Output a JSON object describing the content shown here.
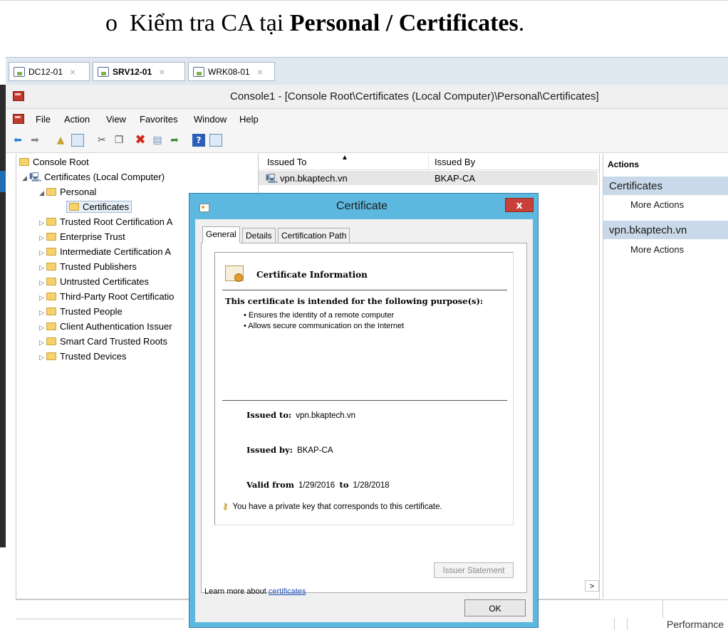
{
  "doc": {
    "bullet": "o",
    "heading_prefix": "Kiểm tra CA tại ",
    "heading_bold": "Personal / Certificates",
    "heading_suffix": "."
  },
  "vm_tabs": [
    {
      "label": "DC12-01",
      "close": "×"
    },
    {
      "label": "SRV12-01",
      "close": "×"
    },
    {
      "label": "WRK08-01",
      "close": "×"
    }
  ],
  "window": {
    "title": "Console1 - [Console Root\\Certificates (Local Computer)\\Personal\\Certificates]"
  },
  "menu": [
    "File",
    "Action",
    "View",
    "Favorites",
    "Window",
    "Help"
  ],
  "tree": {
    "root": "Console Root",
    "store": "Certificates (Local Computer)",
    "personal": "Personal",
    "certificates": "Certificates",
    "items": [
      "Trusted Root Certification A",
      "Enterprise Trust",
      "Intermediate Certification A",
      "Trusted Publishers",
      "Untrusted Certificates",
      "Third-Party Root Certificatio",
      "Trusted People",
      "Client Authentication Issuer",
      "Smart Card Trusted Roots",
      "Trusted Devices"
    ]
  },
  "list": {
    "col_issued_to": "Issued To",
    "col_issued_by": "Issued By",
    "row": {
      "issued_to": "vpn.bkaptech.vn",
      "issued_by": "BKAP-CA"
    }
  },
  "actions": {
    "header": "Actions",
    "group1": "Certificates",
    "group1_item": "More Actions",
    "group2": "vpn.bkaptech.vn",
    "group2_item": "More Actions"
  },
  "status": {
    "perf": "Performance"
  },
  "dialog": {
    "title": "Certificate",
    "close": "x",
    "tabs": [
      "General",
      "Details",
      "Certification Path"
    ],
    "info_title": "Certificate Information",
    "purpose_heading": "This certificate is intended for the following purpose(s):",
    "purposes": [
      "• Ensures the identity of a remote computer",
      "• Allows secure communication on the Internet"
    ],
    "issued_to_label": "Issued to:",
    "issued_to": "vpn.bkaptech.vn",
    "issued_by_label": "Issued by:",
    "issued_by": "BKAP-CA",
    "valid_from_label": "Valid from",
    "valid_from": "1/29/2016",
    "to_label": "to",
    "valid_to": "1/28/2018",
    "private_key_note": "You have a private key that corresponds to this certificate.",
    "issuer_statement": "Issuer Statement",
    "learn_prefix": "Learn more about ",
    "learn_link": "certificates",
    "ok": "OK"
  }
}
